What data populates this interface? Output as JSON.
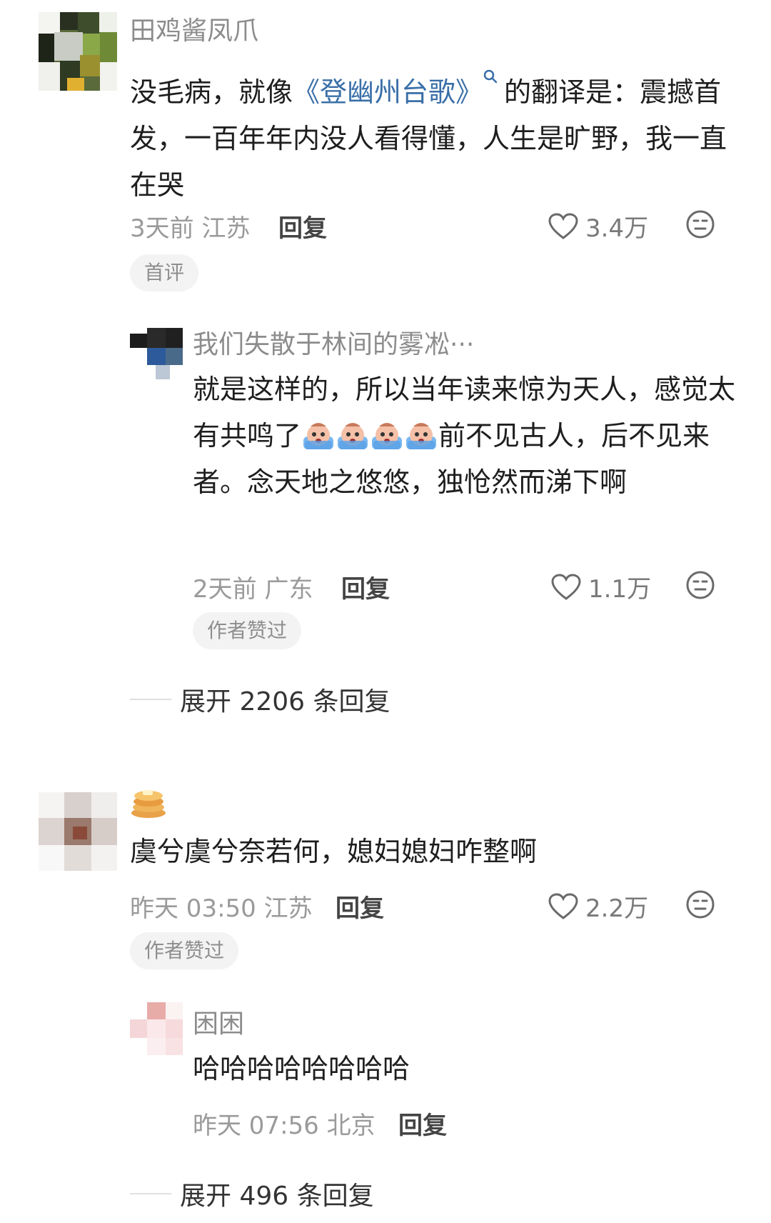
{
  "comment1": {
    "username": "田鸡酱凤爪",
    "text_before": "没毛病，就像",
    "link": "《登幽州台歌》",
    "search_icon": "search-icon",
    "text_after": "的翻译是：震撼首发，一百年年内没人看得懂，人生是旷野，我一直在哭",
    "time_location": "3天前 江苏",
    "reply": "回复",
    "likes": "3.4万",
    "tag": "首评"
  },
  "reply1": {
    "username": "我们失散于林间的雾凇···",
    "text_before": "就是这样的，所以当年读来惊为天人，感觉太有共鸣了",
    "text_after": "前不见古人，后不见来者。念天地之悠悠，独怆然而涕下啊",
    "emoji_name": "crying-emoji",
    "time_location": "2天前 广东",
    "reply": "回复",
    "likes": "1.1万",
    "tag": "作者赞过"
  },
  "expand1": "展开 2206 条回复",
  "comment2": {
    "badge_icon": "pancake-icon",
    "text": "虞兮虞兮奈若何，媳妇媳妇咋整啊",
    "time_location": "昨天 03:50 江苏",
    "reply": "回复",
    "likes": "2.2万",
    "tag": "作者赞过"
  },
  "reply2": {
    "username": "困困",
    "text": "哈哈哈哈哈哈哈哈",
    "time_location": "昨天 07:56 北京",
    "reply": "回复"
  },
  "expand2": "展开 496 条回复",
  "colors": {
    "link": "#3a6fa8",
    "meta": "#9a9a9a",
    "tag_bg": "#f3f3f3"
  }
}
